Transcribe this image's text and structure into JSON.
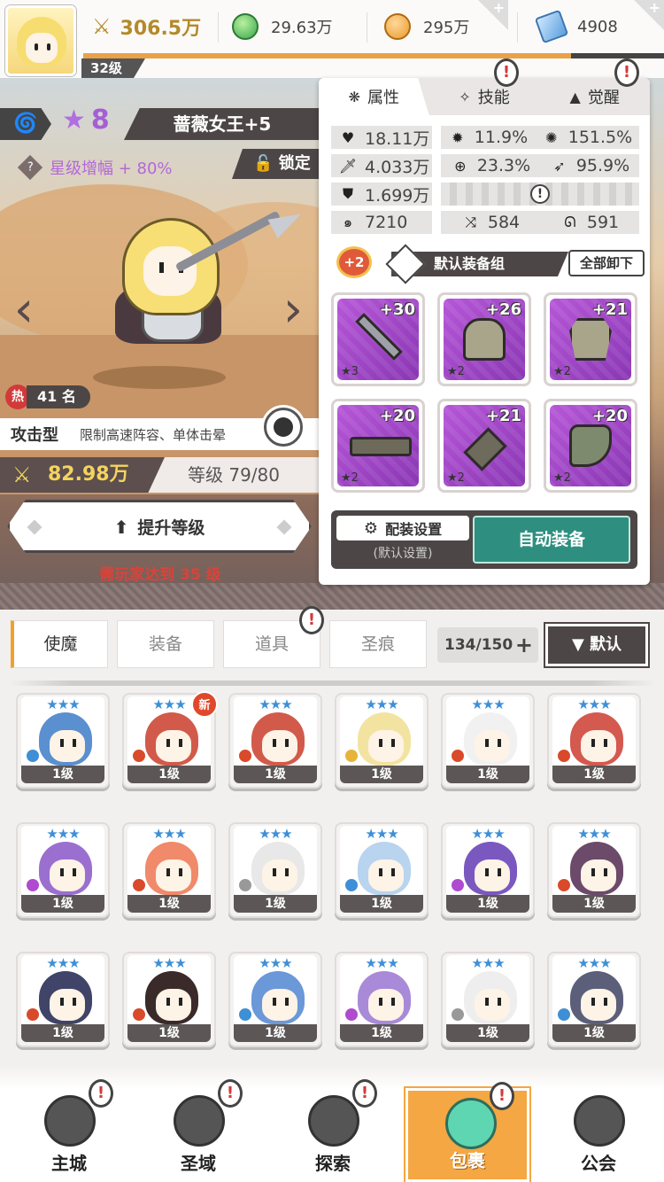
{
  "topbar": {
    "player_level": "32级",
    "level_progress": 0.84,
    "power": "306.5万",
    "gems": "29.63万",
    "coins": "295万",
    "crystals": "4908"
  },
  "hero": {
    "tier_icon": "wind-tier-icon",
    "stars": "8",
    "name": "蔷薇女王+5",
    "star_boost": "星级增幅 + 80%",
    "lock_label": "锁定",
    "hot_label": "热",
    "rank": "41 名",
    "type_label": "攻击型",
    "type_desc": "限制高速阵容、单体击晕",
    "power": "82.98万",
    "level_text": "等级 79/80",
    "level_up_button": "提升等级",
    "requirement": "需玩家达到 35 级"
  },
  "panel": {
    "tabs": [
      {
        "label": "属性",
        "icon": "attribute-icon"
      },
      {
        "label": "技能",
        "icon": "skill-icon"
      },
      {
        "label": "觉醒",
        "icon": "awaken-icon"
      }
    ],
    "stats": {
      "hp": "18.11万",
      "crit": "11.9%",
      "crit_dmg": "151.5%",
      "atk": "4.033万",
      "hit": "23.3%",
      "speed": "95.9%",
      "def": "1.699万",
      "aux": "7210",
      "res1": "584",
      "res2": "591"
    },
    "equip_bonus": "+2",
    "equip_set_label": "默认装备组",
    "unequip_all": "全部卸下",
    "equipment": [
      {
        "slot": "weapon",
        "level": "+30",
        "rank": "★3"
      },
      {
        "slot": "helmet",
        "level": "+26",
        "rank": "★2"
      },
      {
        "slot": "armor",
        "level": "+21",
        "rank": "★2"
      },
      {
        "slot": "belt",
        "level": "+20",
        "rank": "★2"
      },
      {
        "slot": "amulet",
        "level": "+21",
        "rank": "★2"
      },
      {
        "slot": "boots",
        "level": "+20",
        "rank": "★2"
      }
    ],
    "config_label": "配装设置",
    "config_sub": "(默认设置)",
    "auto_equip": "自动装备"
  },
  "inventory": {
    "tabs": [
      "使魔",
      "装备",
      "道具",
      "圣痕"
    ],
    "count": "134/150",
    "sort_label": "▼ 默认",
    "new_badge": "新",
    "cards": [
      {
        "level": "1级",
        "stars": "★★★",
        "element": "water",
        "color": "#5a8fd0"
      },
      {
        "level": "1级",
        "stars": "★★★",
        "element": "fire",
        "color": "#d25a4a",
        "new": true
      },
      {
        "level": "1级",
        "stars": "★★★",
        "element": "fire",
        "color": "#d25a4a"
      },
      {
        "level": "1级",
        "stars": "★★★",
        "element": "light",
        "color": "#f3e3a0"
      },
      {
        "level": "1级",
        "stars": "★★★",
        "element": "fire",
        "color": "#f1f1f1"
      },
      {
        "level": "1级",
        "stars": "★★★",
        "element": "fire",
        "color": "#d4594f"
      },
      {
        "level": "1级",
        "stars": "★★★",
        "element": "dark",
        "color": "#9b6fd0"
      },
      {
        "level": "1级",
        "stars": "★★★",
        "element": "fire",
        "color": "#f08a6a"
      },
      {
        "level": "1级",
        "stars": "★★★",
        "element": "wind",
        "color": "#e8e8e8"
      },
      {
        "level": "1级",
        "stars": "★★★",
        "element": "water",
        "color": "#b8d4ef"
      },
      {
        "level": "1级",
        "stars": "★★★",
        "element": "dark",
        "color": "#7b58c0"
      },
      {
        "level": "1级",
        "stars": "★★★",
        "element": "fire",
        "color": "#6b4a6a"
      },
      {
        "level": "1级",
        "stars": "★★★",
        "element": "fire",
        "color": "#3f4468"
      },
      {
        "level": "1级",
        "stars": "★★★",
        "element": "fire",
        "color": "#3a2a2a"
      },
      {
        "level": "1级",
        "stars": "★★★",
        "element": "water",
        "color": "#6a98d8"
      },
      {
        "level": "1级",
        "stars": "★★★",
        "element": "dark",
        "color": "#a88ad8"
      },
      {
        "level": "1级",
        "stars": "★★★",
        "element": "wind",
        "color": "#eeeeee"
      },
      {
        "level": "1级",
        "stars": "★★★",
        "element": "water",
        "color": "#5b5f7a"
      }
    ]
  },
  "nav": [
    {
      "label": "主城",
      "icon": "castle-icon",
      "alert": true
    },
    {
      "label": "圣域",
      "icon": "vortex-icon",
      "alert": true
    },
    {
      "label": "探索",
      "icon": "sword-in-stone-icon",
      "alert": true
    },
    {
      "label": "包裹",
      "icon": "bag-icon",
      "alert": true,
      "active": true
    },
    {
      "label": "公会",
      "icon": "guild-icon",
      "alert": false
    }
  ]
}
